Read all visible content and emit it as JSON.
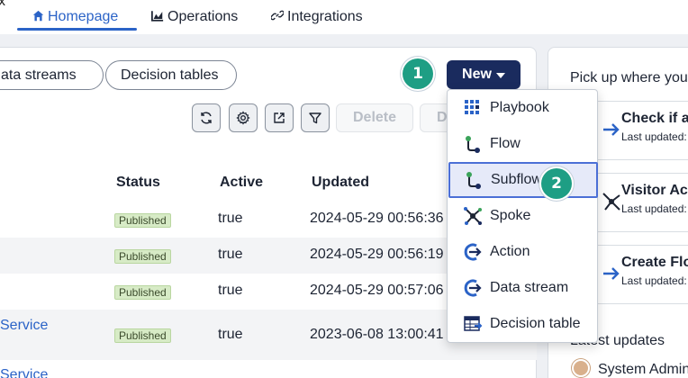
{
  "nav": {
    "stray_glyph": "x",
    "tabs": [
      {
        "label": "Homepage",
        "icon": "home-icon"
      },
      {
        "label": "Operations",
        "icon": "chart-icon"
      },
      {
        "label": "Integrations",
        "icon": "link-icon"
      }
    ]
  },
  "filters": {
    "data_streams": "ata streams",
    "decision_tables": "Decision tables"
  },
  "new_button": {
    "label": "New"
  },
  "step_badges": {
    "one": "1",
    "two": "2"
  },
  "toolbar": {
    "delete_label": "Delete",
    "d_label": "D"
  },
  "table": {
    "columns": {
      "status": "Status",
      "active": "Active",
      "updated": "Updated"
    },
    "rows": [
      {
        "name": "",
        "status": "Published",
        "active": "true",
        "updated": "2024-05-29 00:56:36"
      },
      {
        "name": "",
        "status": "Published",
        "active": "true",
        "updated": "2024-05-29 00:56:19"
      },
      {
        "name": "",
        "status": "Published",
        "active": "true",
        "updated": "2024-05-29 00:57:06"
      },
      {
        "name": "Service",
        "status": "Published",
        "active": "true",
        "updated": "2023-06-08 13:00:41"
      },
      {
        "name": "Service",
        "status": "",
        "active": "",
        "updated": ""
      }
    ]
  },
  "menu": {
    "items": [
      {
        "label": "Playbook",
        "icon": "playbook-icon"
      },
      {
        "label": "Flow",
        "icon": "flow-icon"
      },
      {
        "label": "Subflow",
        "icon": "subflow-icon"
      },
      {
        "label": "Spoke",
        "icon": "spoke-icon"
      },
      {
        "label": "Action",
        "icon": "action-icon"
      },
      {
        "label": "Data stream",
        "icon": "data-stream-icon"
      },
      {
        "label": "Decision table",
        "icon": "decision-table-icon"
      }
    ]
  },
  "right_panel": {
    "title": "Pick up where you",
    "cards": [
      {
        "title": "Check if a",
        "subtitle": "Last updated:"
      },
      {
        "title": "Visitor Acc",
        "subtitle": "Last updated:"
      },
      {
        "title": "Create Flo",
        "subtitle": "Last updated:"
      }
    ],
    "latest_label": "Latest updates",
    "user": "System Admin"
  },
  "colors": {
    "accent": "#2b63c7",
    "new_button": "#1a2b5e",
    "step_badge": "#1e9e84",
    "published_badge": "#d7ebc6",
    "menu_highlight": "#e6eaf9"
  }
}
